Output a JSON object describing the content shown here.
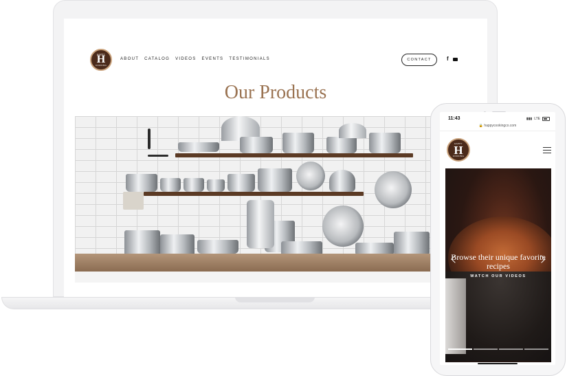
{
  "desktop": {
    "logo": {
      "top_text": "HAPPY",
      "letter": "H",
      "bottom_text": "COOKING"
    },
    "nav": [
      "ABOUT",
      "CATALOG",
      "VIDEOS",
      "EVENTS",
      "TESTIMONIALS"
    ],
    "contact_label": "CONTACT",
    "social_icons": [
      "facebook-icon",
      "youtube-icon"
    ],
    "page_title": "Our Products",
    "hero_image": "stainless-steel-cookware-on-shelves"
  },
  "mobile": {
    "status_time": "11:43",
    "status_network": "LTE",
    "url": "happycookingco.com",
    "logo": {
      "top_text": "HAPPY",
      "letter": "H",
      "bottom_text": "COOKING"
    },
    "hero": {
      "headline": "Browse their unique favorite recipes",
      "cta": "WATCH OUR VIDEOS",
      "slides": 4,
      "active_slide": 1
    }
  },
  "colors": {
    "brand_brown": "#4b2a1a",
    "title_tan": "#9a7352",
    "logo_ring": "#c9a27c"
  }
}
